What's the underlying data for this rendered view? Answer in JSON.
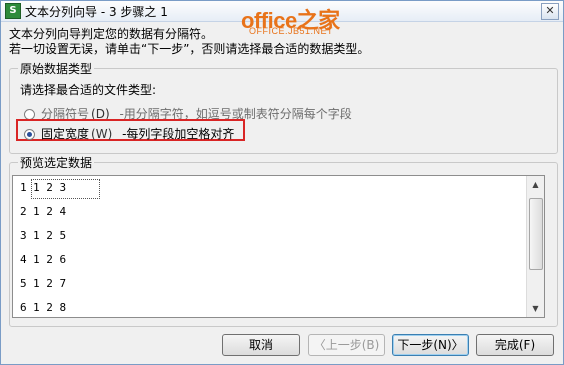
{
  "window": {
    "title": "文本分列向导 - 3 步骤之 1",
    "app_icon_glyph": "S",
    "close_glyph": "✕"
  },
  "logo": {
    "main": "office之家",
    "sub": "OFFICE.JB51.NET",
    "color": "#e8731a"
  },
  "intro": {
    "line1": "文本分列向导判定您的数据有分隔符。",
    "line2": "若一切设置无误，请单击“下一步”，否则请选择最合适的数据类型。"
  },
  "original_type": {
    "group_title": "原始数据类型",
    "prompt": "请选择最合适的文件类型:",
    "options": [
      {
        "label": "分隔符号",
        "shortcut": "(D)",
        "desc": "-用分隔字符，如逗号或制表符分隔每个字段",
        "selected": false
      },
      {
        "label": "固定宽度",
        "shortcut": "(W)",
        "desc": "-每列字段加空格对齐",
        "selected": true
      }
    ],
    "highlight_color": "#d92525"
  },
  "preview": {
    "group_title": "预览选定数据",
    "rows": [
      {
        "num": "1",
        "value": "1 2 3"
      },
      {
        "num": "2",
        "value": "1 2 4"
      },
      {
        "num": "3",
        "value": "1 2 5"
      },
      {
        "num": "4",
        "value": "1 2 6"
      },
      {
        "num": "5",
        "value": "1 2 7"
      },
      {
        "num": "6",
        "value": "1 2 8"
      }
    ]
  },
  "buttons": {
    "cancel": "取消",
    "back": "〈上一步(B)",
    "next": "下一步(N)〉",
    "finish": "完成(F)"
  }
}
